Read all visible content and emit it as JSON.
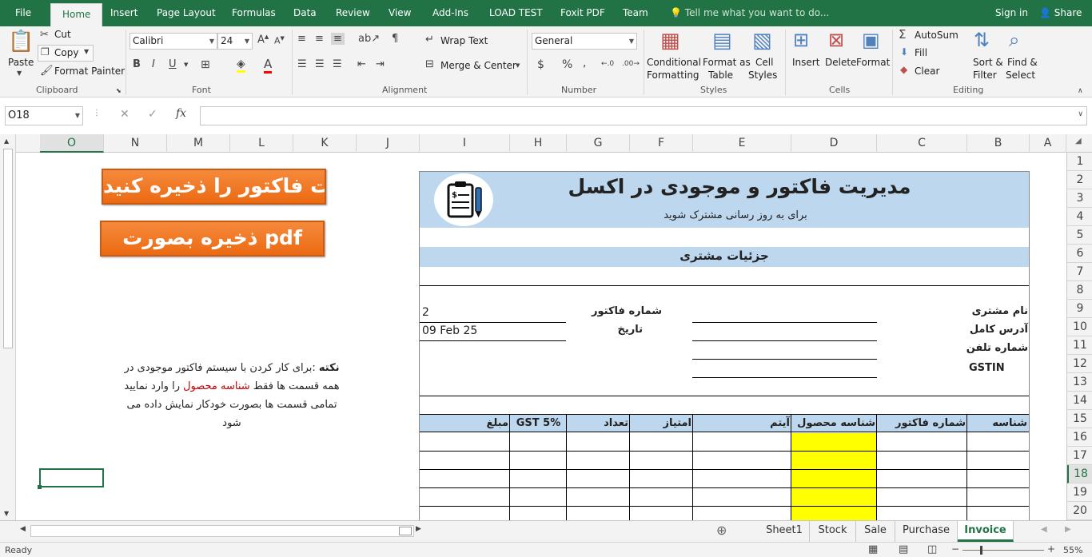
{
  "ribbon_tabs": [
    "File",
    "Home",
    "Insert",
    "Page Layout",
    "Formulas",
    "Data",
    "Review",
    "View",
    "Add-Ins",
    "LOAD TEST",
    "Foxit PDF",
    "Team"
  ],
  "active_tab": "Home",
  "tell_me": "Tell me what you want to do...",
  "sign_in": "Sign in",
  "share": "Share",
  "clipboard": {
    "paste": "Paste",
    "cut": "Cut",
    "copy": "Copy",
    "format_painter": "Format Painter",
    "label": "Clipboard"
  },
  "font": {
    "name": "Calibri",
    "size": "24",
    "bold": "B",
    "italic": "I",
    "underline": "U",
    "label": "Font"
  },
  "alignment": {
    "wrap_text": "Wrap Text",
    "merge_center": "Merge & Center",
    "label": "Alignment"
  },
  "number": {
    "format": "General",
    "currency": "$",
    "percent": "%",
    "comma": ",",
    "label": "Number"
  },
  "styles": {
    "conditional_1": "Conditional",
    "conditional_2": "Formatting",
    "format_table_1": "Format as",
    "format_table_2": "Table",
    "cell_styles_1": "Cell",
    "cell_styles_2": "Styles",
    "label": "Styles"
  },
  "cells": {
    "insert": "Insert",
    "delete": "Delete",
    "format": "Format",
    "label": "Cells"
  },
  "editing": {
    "autosum": "AutoSum",
    "fill": "Fill",
    "clear": "Clear",
    "sort_1": "Sort &",
    "sort_2": "Filter",
    "find_1": "Find &",
    "find_2": "Select",
    "label": "Editing"
  },
  "formula_bar": {
    "name_box": "O18",
    "cancel": "✕",
    "enter": "✓",
    "fx": "fx",
    "formula": ""
  },
  "columns": [
    "O",
    "N",
    "M",
    "L",
    "K",
    "J",
    "I",
    "H",
    "G",
    "F",
    "E",
    "D",
    "C",
    "B",
    "A"
  ],
  "rows": [
    "1",
    "2",
    "3",
    "4",
    "5",
    "6",
    "7",
    "8",
    "9",
    "10",
    "11",
    "12",
    "13",
    "14",
    "15",
    "16",
    "17",
    "18",
    "19",
    "20"
  ],
  "selected_row": "18",
  "buttons": {
    "save_invoice": "ثبت فاکتور را ذخیره کنید",
    "save_pdf": "ذخیره بصورت pdf"
  },
  "note": {
    "bold_prefix": "نکته",
    "line1_rest": " :برای کار کردن با سیستم فاکتور موجودی در",
    "line2_before": "همه قسمت ها فقط ",
    "line2_red": "شناسه محصول",
    "line2_after": " را وارد نمایید",
    "line3": "تمامی قسمت ها بصورت خودکار نمایش داده می",
    "line4": "شود"
  },
  "invoice": {
    "title": "مدیریت فاکتور و موجودی در اکسل",
    "subtitle": "برای به روز رسانی مشترک شوید",
    "customer_section": "جزئیات مشتری",
    "invoice_no_label": "شماره فاکتور",
    "invoice_no": "2",
    "date_label": "تاریخ",
    "date": "09 Feb 25",
    "customer_name": "نام مشتری",
    "full_address": "آدرس کامل",
    "phone": "شماره تلفن",
    "gstin": "GSTIN",
    "table_headers": [
      "شناسه",
      "شماره فاکتور",
      "شناسه محصول",
      "آیتم",
      "امتیاز",
      "تعداد",
      "GST 5%",
      "مبلغ"
    ]
  },
  "sheet_tabs": [
    "Sheet1",
    "Stock",
    "Sale",
    "Purchase",
    "Invoice"
  ],
  "active_sheet": "Invoice",
  "status": {
    "ready": "Ready",
    "zoom": "55%"
  },
  "colors": {
    "excel_green": "#217346",
    "header_blue": "#bdd7ee",
    "yellow": "#ffff00",
    "orange": "#ed7d31",
    "note_red": "#c00000"
  }
}
